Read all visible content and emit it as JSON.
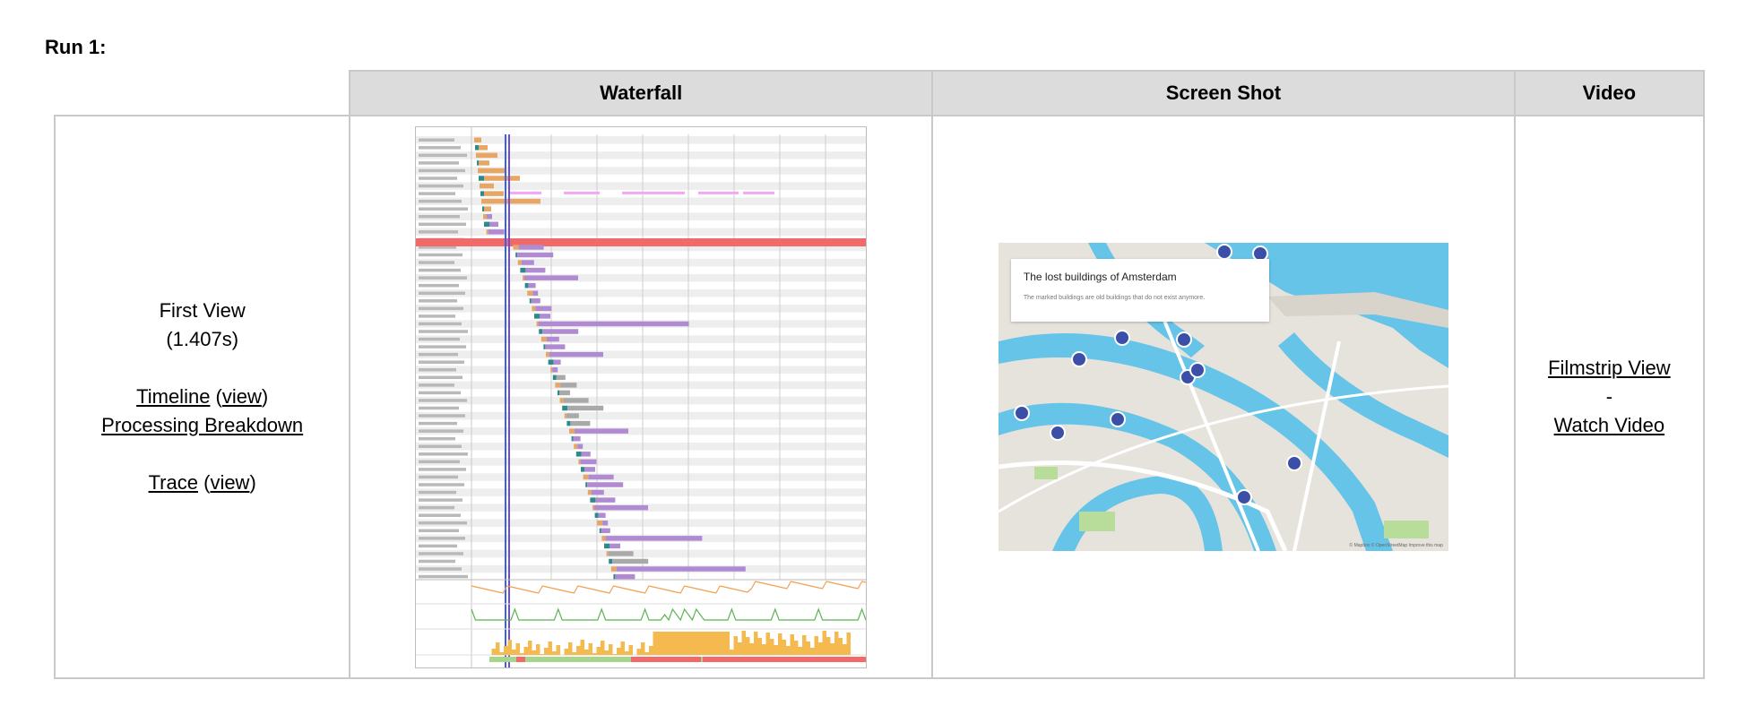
{
  "run_label": "Run 1:",
  "headers": {
    "waterfall": "Waterfall",
    "screenshot": "Screen Shot",
    "video": "Video"
  },
  "first_view": {
    "title": "First View",
    "time": "(1.407s)",
    "timeline": "Timeline",
    "timeline_view": "view",
    "processing_breakdown": "Processing Breakdown",
    "trace": "Trace",
    "trace_view": "view"
  },
  "video_links": {
    "filmstrip": "Filmstrip View",
    "separator": "-",
    "watch": "Watch Video"
  },
  "screenshot": {
    "card_title": "The lost buildings of Amsterdam",
    "card_subtitle": "The marked buildings are old buildings that do not exist anymore.",
    "attribution": "© Mapbox © OpenStreetMap Improve this map"
  },
  "colors": {
    "header_bg": "#dcdcdc",
    "border": "#c9c9c9",
    "bar_purple": "#b08bd1",
    "bar_orange": "#e7a663",
    "bar_gray": "#a9a9a9",
    "bar_teal": "#2c8a8a",
    "highlight_row": "#f26969",
    "marker_blue": "#3f5ee8",
    "cpu_orange": "#f4b94f",
    "bandwidth_green": "#5bb552",
    "map_water": "#65c4e8",
    "map_pin": "#3c4fa8"
  }
}
